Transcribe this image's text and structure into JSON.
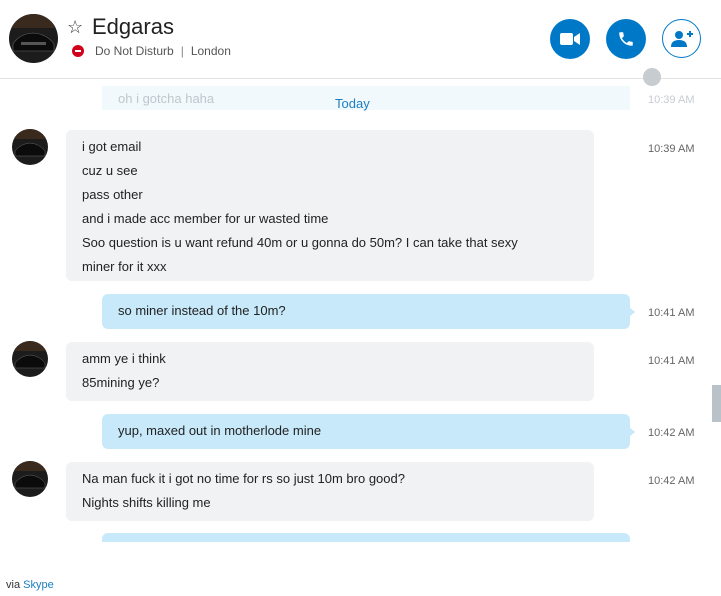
{
  "header": {
    "name": "Edgaras",
    "status": "Do Not Disturb",
    "separator": "|",
    "location": "London"
  },
  "ghost_message": {
    "text": "oh i gotcha haha",
    "time": "10:39 AM"
  },
  "date_divider": "Today",
  "messages": [
    {
      "direction": "in",
      "time": "10:39 AM",
      "lines": [
        "i got email",
        "cuz u see",
        "pass other",
        "and i made acc member for ur wasted time",
        "Soo question is u want refund 40m or u gonna do 50m? I can take that sexy",
        "miner for it xxx"
      ]
    },
    {
      "direction": "out",
      "time": "10:41 AM",
      "lines": [
        "so miner instead of the 10m?"
      ]
    },
    {
      "direction": "in",
      "time": "10:41 AM",
      "lines": [
        "amm ye i think",
        "85mining ye?"
      ]
    },
    {
      "direction": "out",
      "time": "10:42 AM",
      "lines": [
        "yup, maxed out in motherlode mine"
      ]
    },
    {
      "direction": "in",
      "time": "10:42 AM",
      "lines": [
        "Na man fuck it i got no time for rs so just 10m bro good?",
        "Nights shifts killing me"
      ]
    }
  ],
  "footer": {
    "prefix": "via",
    "link": "Skype"
  },
  "icons": {
    "favorite": "star-icon",
    "dnd": "do-not-disturb-icon",
    "video": "video-call-icon",
    "call": "phone-icon",
    "add": "add-person-icon",
    "globe": "globe-icon"
  },
  "colors": {
    "accent": "#0078c8",
    "outgoing_bubble": "#c7e9f9",
    "incoming_bubble": "#f1f2f4",
    "dnd_red": "#d0021b",
    "link": "#1a7fc1"
  }
}
